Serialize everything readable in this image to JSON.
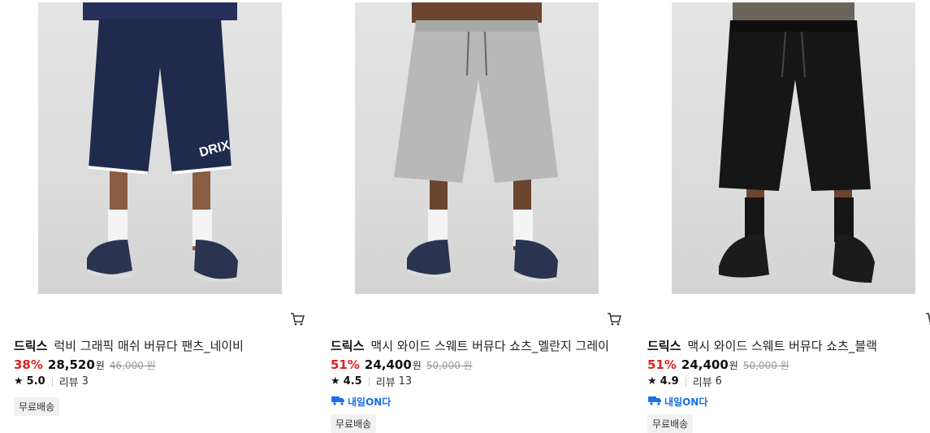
{
  "products": [
    {
      "brand": "드릭스",
      "name": "럭비 그래픽 매쉬 버뮤다 팬츠_네이비",
      "discount": "38%",
      "price": "28,520",
      "currency": "원",
      "original_price": "46,000 원",
      "rating": "5.0",
      "review_label": "리뷰",
      "review_count": "3",
      "badge": "무료배송",
      "shorts_color": "#1f2a4d",
      "sock_color": "#f4f4f4",
      "shoe_color": "#2a3350",
      "shorts_text": "DRIX",
      "image_icon": "navy-bermuda-shorts-photo"
    },
    {
      "brand": "드릭스",
      "name": "맥시 와이드 스웨트 버뮤다 쇼츠_멜란지 그레이",
      "discount": "51%",
      "price": "24,400",
      "currency": "원",
      "original_price": "50,000 원",
      "rating": "4.5",
      "review_label": "리뷰",
      "review_count": "13",
      "delivery_label": "내일ON다",
      "badge": "무료배송",
      "shorts_color": "#b8b8b8",
      "sock_color": "#f4f4f4",
      "shoe_color": "#2a3350",
      "image_icon": "grey-sweat-shorts-photo"
    },
    {
      "brand": "드릭스",
      "name": "맥시 와이드 스웨트 버뮤다 쇼츠_블랙",
      "discount": "51%",
      "price": "24,400",
      "currency": "원",
      "original_price": "50,000 원",
      "rating": "4.9",
      "review_label": "리뷰",
      "review_count": "6",
      "delivery_label": "내일ON다",
      "badge": "무료배송",
      "shorts_color": "#161616",
      "sock_color": "#151515",
      "shoe_color": "#1b1b1b",
      "image_icon": "black-sweat-shorts-photo"
    }
  ],
  "icons": {
    "cart": "cart-icon",
    "star": "star-icon",
    "delivery": "truck-icon"
  },
  "colors": {
    "discount": "#e0201f",
    "delivery": "#1a6fe6"
  }
}
